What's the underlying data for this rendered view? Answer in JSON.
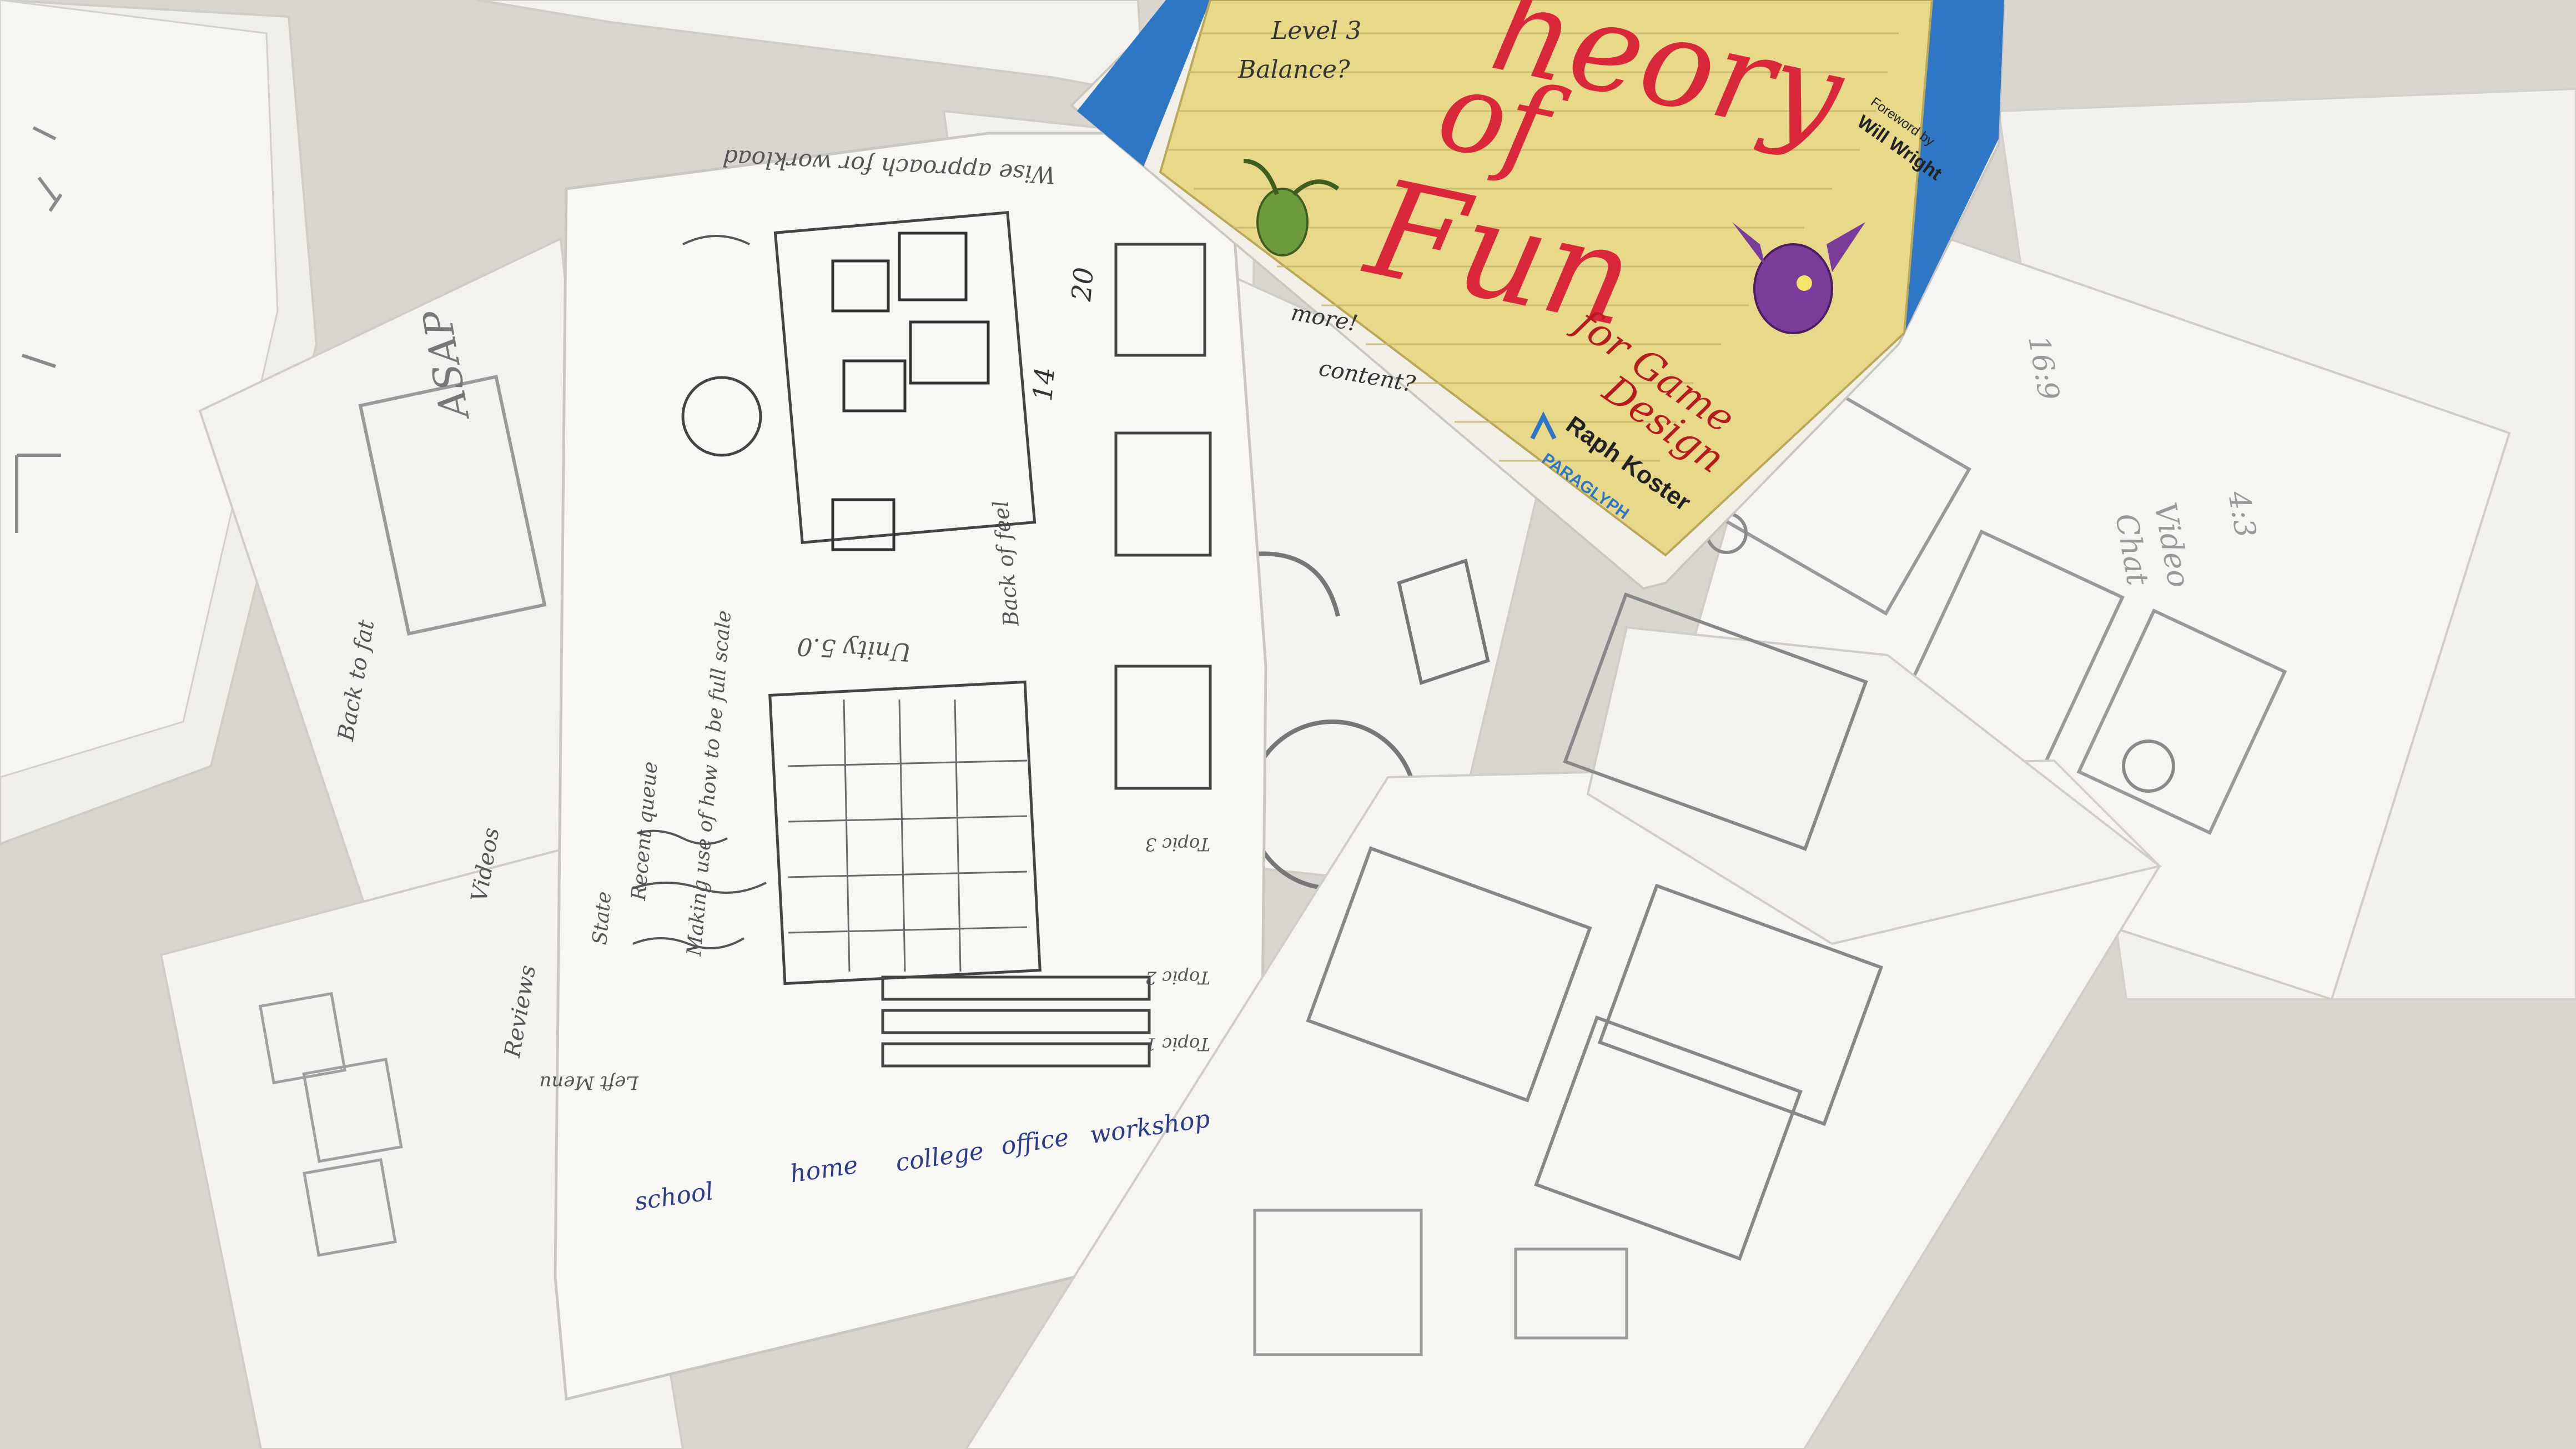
{
  "book": {
    "title_line1": "heory",
    "title_line2": "of",
    "title_line3": "Fun",
    "subtitle_line1": "for Game",
    "subtitle_line2": "Design",
    "author": "Raph Koster",
    "foreword_line1": "Foreword by",
    "foreword_line2": "Will Wright",
    "publisher": "PARAGLYPH",
    "notes": [
      "Level 3",
      "Balance?",
      "more!",
      "content?"
    ],
    "colors": {
      "cover": "#e8d98a",
      "spine": "#2f76c4",
      "title": "#d8283a",
      "monster": "#7a3c9a"
    }
  },
  "sketches": {
    "main_sheet": {
      "top_note": "Wise approach for workload",
      "tabs": [
        "school",
        "home",
        "college",
        "office",
        "workshop"
      ],
      "labels": [
        "Unity 5.0",
        "Back of feel",
        "Making use of how to be full scale",
        "State",
        "Recent queue",
        "Topic 1",
        "Topic 2",
        "Topic 3",
        "Left Menu",
        "20",
        "14"
      ]
    },
    "left_sheet": {
      "labels": [
        "ASAP",
        "Back to fat",
        "Videos",
        "Reviews"
      ]
    },
    "right_sheet": {
      "labels": [
        "Video",
        "Chat",
        "4:3",
        "16:9"
      ]
    }
  },
  "colors": {
    "table": "#d9d7cf",
    "paper": "#f5f4f0",
    "pencil": "#6a6a6a",
    "ink": "#3a3a3a"
  }
}
